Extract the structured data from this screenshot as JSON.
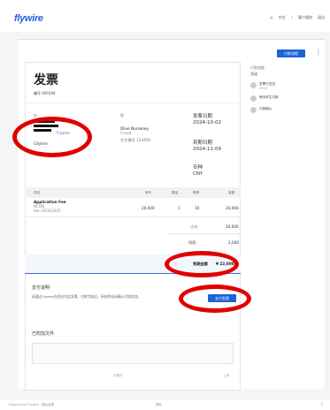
{
  "brand": {
    "logo": "flywire",
    "tagline": ""
  },
  "topnav": {
    "lang": "中文",
    "dropdown": "v",
    "user": "客户服务",
    "menu": "退出"
  },
  "toolbar": {
    "primary_label": "付款流程",
    "kebab": "⋮"
  },
  "timeline": {
    "heading": "付款进度",
    "subheading": "活动",
    "items": [
      {
        "title": "发票已发送",
        "sub": "2024"
      },
      {
        "title": "等待学生付款",
        "sub": ""
      },
      {
        "title": "付款确认",
        "sub": ""
      }
    ]
  },
  "invoice": {
    "title": "发票",
    "number_label": "编号 000104",
    "from_label": "自",
    "from_link": "Flywire",
    "from_city": "Cityline",
    "to_label": "致",
    "to_name": "Olive Nurseney",
    "to_sub": "Creed",
    "to_id": "学生编号 123456",
    "issue_label": "发票日期",
    "issue_date": "2024-10-02",
    "due_label": "到期日期",
    "due_date": "2024-11-09",
    "currency_label": "币种",
    "currency": "CNY"
  },
  "table": {
    "headers": [
      "项目",
      "单价",
      "数量",
      "税率",
      "金额"
    ],
    "item_name": "Application Fee",
    "item_sub1": "NCDN",
    "item_sub2": "fee 2024/2025",
    "unit_price": "20,000",
    "qty": "1",
    "tax": "10",
    "amount": "20,000",
    "subtotal_label": "小计",
    "subtotal": "20,000",
    "tax_total_label": "税额",
    "tax_total": "2,000",
    "total_label": "到期金额",
    "total_value": "¥ 22,000"
  },
  "payment": {
    "title": "支付说明",
    "text": "请通过Flywire在线支付此发票。付款完成后，系统将自动确认付款状态。",
    "button": "支付发票"
  },
  "attachments": {
    "title": "已附加文件",
    "left_foot": "无附件",
    "right_foot": "上传"
  },
  "bottombar": {
    "left": "Powered by Flywire · 隐私政策",
    "mid": "帮助",
    "right": "©"
  }
}
